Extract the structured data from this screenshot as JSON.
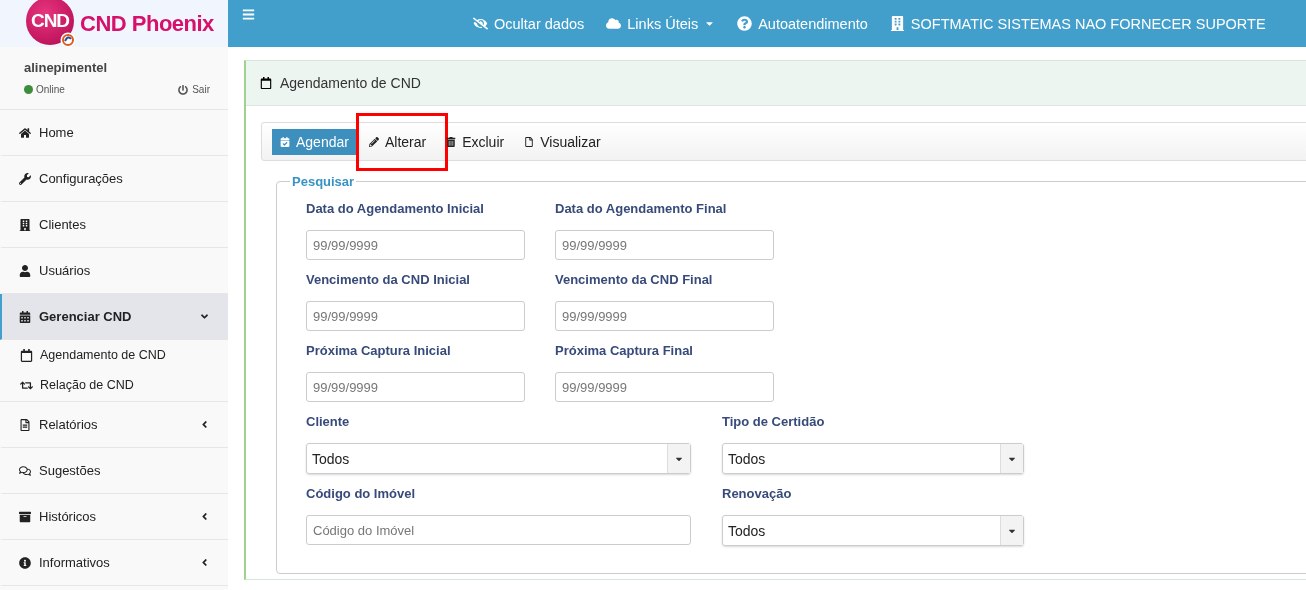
{
  "logo": {
    "badge": "CND",
    "name": "CND Phoenix"
  },
  "topbar": {
    "items": [
      {
        "label": "Ocultar dados",
        "dropdown": false
      },
      {
        "label": "Links Úteis",
        "dropdown": true
      },
      {
        "label": "Autoatendimento",
        "dropdown": false
      },
      {
        "label": "SOFTMATIC SISTEMAS NAO FORNECER SUPORTE",
        "dropdown": false
      }
    ]
  },
  "user": {
    "name": "alinepimentel",
    "status": "Online",
    "logout": "Sair"
  },
  "sidebar": {
    "items": [
      {
        "label": "Home",
        "selected": false
      },
      {
        "label": "Configurações",
        "selected": false
      },
      {
        "label": "Clientes",
        "selected": false
      },
      {
        "label": "Usuários",
        "selected": false
      },
      {
        "label": "Gerenciar CND",
        "selected": true,
        "expanded": true,
        "children": [
          {
            "label": "Agendamento de CND"
          },
          {
            "label": "Relação de CND"
          }
        ]
      },
      {
        "label": "Relatórios",
        "selected": false,
        "expanded": false
      },
      {
        "label": "Sugestões",
        "selected": false
      },
      {
        "label": "Históricos",
        "selected": false,
        "expanded": false
      },
      {
        "label": "Informativos",
        "selected": false,
        "expanded": false
      }
    ]
  },
  "panel": {
    "title": "Agendamento de CND",
    "toolbar": [
      {
        "label": "Agendar",
        "primary": true,
        "highlighted": false
      },
      {
        "label": "Alterar",
        "primary": false,
        "highlighted": true
      },
      {
        "label": "Excluir",
        "primary": false,
        "highlighted": false
      },
      {
        "label": "Visualizar",
        "primary": false,
        "highlighted": false
      }
    ],
    "search": {
      "legend": "Pesquisar",
      "date_fields": [
        {
          "label": "Data do Agendamento Inicial",
          "placeholder": "99/99/9999"
        },
        {
          "label": "Data do Agendamento Final",
          "placeholder": "99/99/9999"
        },
        {
          "label": "Vencimento da CND Inicial",
          "placeholder": "99/99/9999"
        },
        {
          "label": "Vencimento da CND Final",
          "placeholder": "99/99/9999"
        },
        {
          "label": "Próxima Captura Inicial",
          "placeholder": "99/99/9999"
        },
        {
          "label": "Próxima Captura Final",
          "placeholder": "99/99/9999"
        }
      ],
      "fields": [
        {
          "kind": "select",
          "label": "Cliente",
          "value": "Todos"
        },
        {
          "kind": "select",
          "label": "Tipo de Certidão",
          "value": "Todos"
        },
        {
          "kind": "text",
          "label": "Código do Imóvel",
          "placeholder": "Código do Imóvel"
        },
        {
          "kind": "select",
          "label": "Renovação",
          "value": "Todos"
        }
      ]
    }
  }
}
